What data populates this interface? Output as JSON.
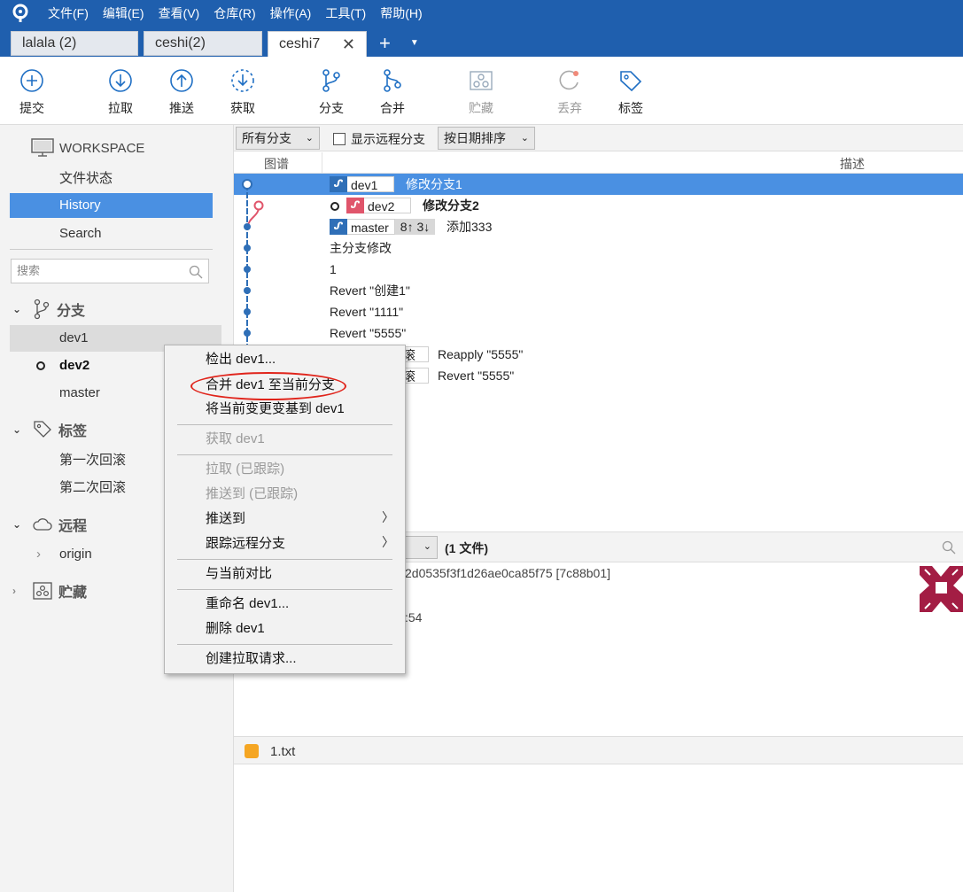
{
  "menu": [
    "文件(F)",
    "编辑(E)",
    "查看(V)",
    "仓库(R)",
    "操作(A)",
    "工具(T)",
    "帮助(H)"
  ],
  "tabs": [
    "lalala (2)",
    "ceshi(2)",
    "ceshi7"
  ],
  "toolbar": {
    "commit": "提交",
    "pull": "拉取",
    "push": "推送",
    "fetch": "获取",
    "branch": "分支",
    "merge": "合并",
    "stash": "贮藏",
    "discard": "丢弃",
    "tag": "标签"
  },
  "sidebar": {
    "workspace": "WORKSPACE",
    "nav": [
      "文件状态",
      "History",
      "Search"
    ],
    "search_placeholder": "搜索",
    "branches_title": "分支",
    "branches": [
      "dev1",
      "dev2",
      "master"
    ],
    "tags_title": "标签",
    "tags": [
      "第一次回滚",
      "第二次回滚"
    ],
    "remotes_title": "远程",
    "remotes": [
      "origin"
    ],
    "stash_title": "贮藏"
  },
  "filter": {
    "all_branches": "所有分支",
    "show_remote": "显示远程分支",
    "sort": "按日期排序"
  },
  "columns": {
    "graph": "图谱",
    "desc": "描述"
  },
  "commits": [
    {
      "branch": "dev1",
      "message": "修改分支1"
    },
    {
      "branch": "dev2",
      "message": "修改分支2"
    },
    {
      "branch": "master",
      "ahead_behind": "8↑ 3↓",
      "message": "添加333"
    },
    {
      "message": "主分支修改"
    },
    {
      "message": "1"
    },
    {
      "message": "Revert \"创建1\""
    },
    {
      "message": "Revert \"1111\""
    },
    {
      "message": "Revert \"5555\""
    },
    {
      "tag_frag": "滚",
      "message": "Reapply \"5555\""
    },
    {
      "tag_frag": "滚",
      "message": "Revert \"5555\""
    }
  ],
  "details": {
    "files_count": "(1 文件)",
    "hash_frag": "2d0535f3f1d26ae0ca85f75 [7c88b01]",
    "time_frag": ":54",
    "file": "1.txt"
  },
  "context_menu": {
    "checkout": "检出 dev1...",
    "merge": "合并 dev1 至当前分支",
    "rebase": "将当前变更变基到 dev1",
    "fetch": "获取 dev1",
    "pull": "拉取 (已跟踪)",
    "push_tracked": "推送到 (已跟踪)",
    "push_to": "推送到",
    "track": "跟踪远程分支",
    "compare": "与当前对比",
    "rename": "重命名 dev1...",
    "delete": "删除 dev1",
    "pr": "创建拉取请求..."
  },
  "colors": {
    "title_bar": "#1f5fae",
    "selection": "#4a90e2",
    "highlight_oval": "#e0241b"
  }
}
